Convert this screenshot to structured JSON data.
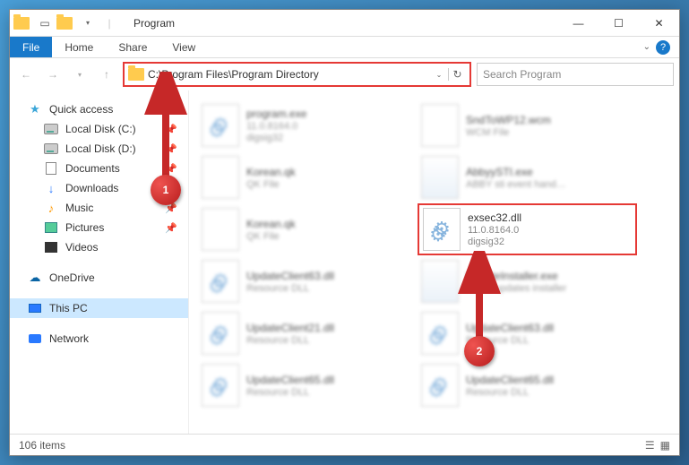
{
  "titlebar": {
    "title": "Program"
  },
  "ribbon": {
    "file": "File",
    "tabs": [
      "Home",
      "Share",
      "View"
    ]
  },
  "nav": {
    "address": "C:\\Program Files\\Program Directory",
    "search_placeholder": "Search Program"
  },
  "sidebar": {
    "quick_access": "Quick access",
    "items_pinned": [
      {
        "label": "Local Disk (C:)"
      },
      {
        "label": "Local Disk (D:)"
      },
      {
        "label": "Documents"
      },
      {
        "label": "Downloads"
      },
      {
        "label": "Music"
      },
      {
        "label": "Pictures"
      },
      {
        "label": "Videos"
      }
    ],
    "onedrive": "OneDrive",
    "thispc": "This PC",
    "network": "Network"
  },
  "files": [
    {
      "name": "program.exe",
      "meta1": "11.0.8164.0",
      "meta2": "digsig32"
    },
    {
      "name": "SndToWP12.wcm",
      "meta1": "WCM File",
      "meta2": ""
    },
    {
      "name": "Korean.qk",
      "meta1": "QK File",
      "meta2": ""
    },
    {
      "name": "AbbyySTI.exe",
      "meta1": "ABBY sti event hand…",
      "meta2": ""
    },
    {
      "name": "Korean.qk",
      "meta1": "QK File",
      "meta2": ""
    },
    {
      "name": "exsec32.dll",
      "meta1": "11.0.8164.0",
      "meta2": "digsig32"
    },
    {
      "name": "UpdateClient63.dll",
      "meta1": "Resource DLL",
      "meta2": ""
    },
    {
      "name": "UpdateInstaller.exe",
      "meta1": "ABBY updates installer",
      "meta2": ""
    },
    {
      "name": "UpdateClient21.dll",
      "meta1": "Resource DLL",
      "meta2": ""
    },
    {
      "name": "UpdateClient63.dll",
      "meta1": "Resource DLL",
      "meta2": ""
    },
    {
      "name": "UpdateClient65.dll",
      "meta1": "Resource DLL",
      "meta2": ""
    },
    {
      "name": "UpdateClient65.dll",
      "meta1": "Resource DLL",
      "meta2": ""
    }
  ],
  "status": {
    "count": "106 items"
  },
  "callouts": {
    "c1": "1",
    "c2": "2"
  }
}
